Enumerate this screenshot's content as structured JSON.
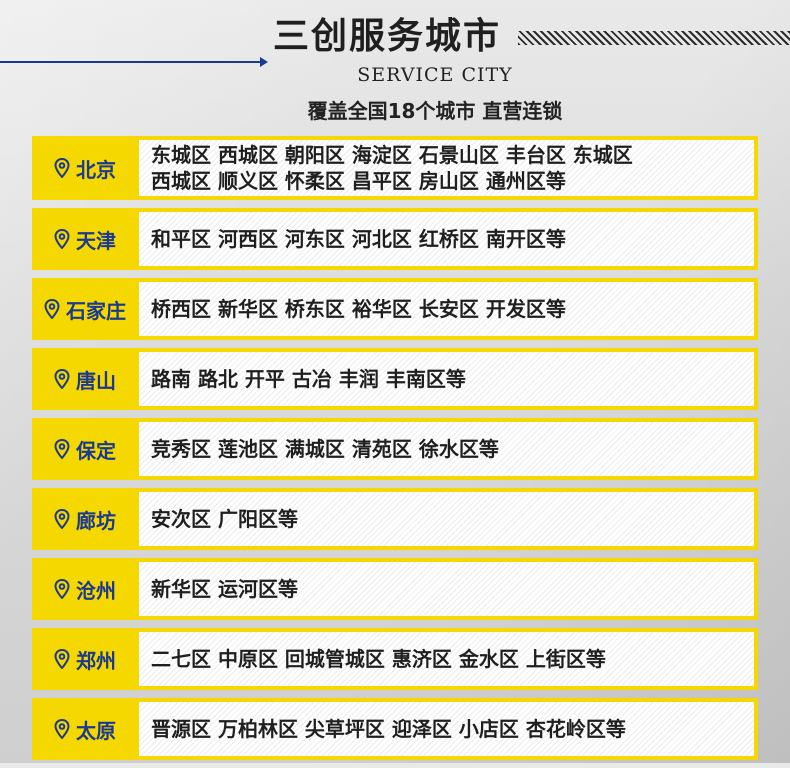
{
  "header": {
    "title": "三创服务城市",
    "subtitle_en": "SERVICE CITY",
    "tagline": "覆盖全国18个城市 直营连锁"
  },
  "colors": {
    "accent_yellow": "#f5d800",
    "brand_blue": "#1b3a8f"
  },
  "cities": [
    {
      "name": "北京",
      "districts": [
        "东城区 西城区 朝阳区 海淀区 石景山区 丰台区 东城区",
        "西城区 顺义区 怀柔区 昌平区 房山区 通州区等"
      ]
    },
    {
      "name": "天津",
      "districts": [
        "和平区 河西区 河东区 河北区 红桥区 南开区等"
      ]
    },
    {
      "name": "石家庄",
      "districts": [
        "桥西区 新华区 桥东区 裕华区 长安区 开发区等"
      ]
    },
    {
      "name": "唐山",
      "districts": [
        "路南 路北 开平 古冶 丰润 丰南区等"
      ]
    },
    {
      "name": "保定",
      "districts": [
        "竞秀区 莲池区 满城区 清苑区 徐水区等"
      ]
    },
    {
      "name": "廊坊",
      "districts": [
        "安次区 广阳区等"
      ]
    },
    {
      "name": "沧州",
      "districts": [
        "新华区 运河区等"
      ]
    },
    {
      "name": "郑州",
      "districts": [
        "二七区 中原区 回城管城区 惠济区 金水区 上街区等"
      ]
    },
    {
      "name": "太原",
      "districts": [
        "晋源区 万柏林区 尖草坪区 迎泽区 小店区 杏花岭区等"
      ]
    }
  ]
}
